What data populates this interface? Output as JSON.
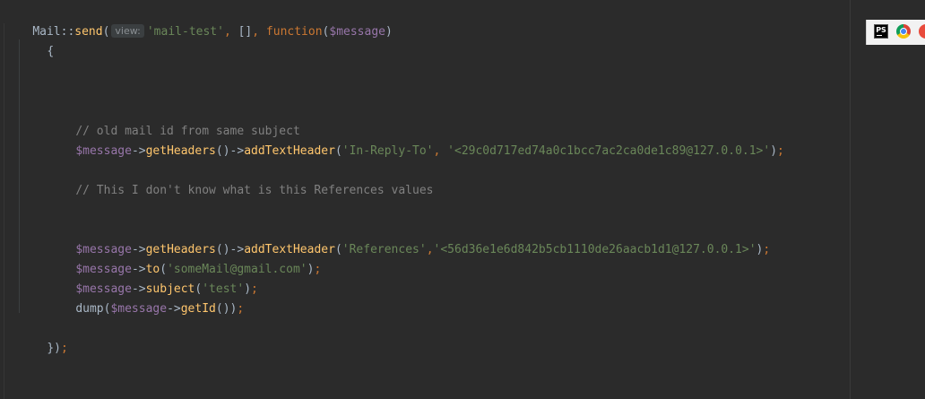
{
  "code": {
    "line1": {
      "class": "Mail",
      "sep": "::",
      "method": "send",
      "open": "(",
      "param_hint": "view:",
      "view_arg": "'mail-test'",
      "comma1": ", ",
      "array": "[]",
      "comma2": ", ",
      "keyword": "function",
      "paren_open": "(",
      "param": "$message",
      "paren_close": ")"
    },
    "line2": {
      "brace": "{"
    },
    "comment1": "// old mail id from same subject",
    "line_irt": {
      "var": "$message",
      "arrow1": "->",
      "fn1": "getHeaders",
      "p1": "()",
      "arrow2": "->",
      "fn2": "addTextHeader",
      "open": "(",
      "arg1": "'In-Reply-To'",
      "comma": ", ",
      "arg2": "'<29c0d717ed74a0c1bcc7ac2ca0de1c89@127.0.0.1>'",
      "close": ")",
      "semi": ";"
    },
    "comment2": "// This I don't know what is this References values",
    "line_refs": {
      "var": "$message",
      "arrow1": "->",
      "fn1": "getHeaders",
      "p1": "()",
      "arrow2": "->",
      "fn2": "addTextHeader",
      "open": "(",
      "arg1": "'References'",
      "comma": ",",
      "arg2": "'<56d36e1e6d842b5cb1110de26aacb1d1@127.0.0.1>'",
      "close": ")",
      "semi": ";"
    },
    "line_to": {
      "var": "$message",
      "arrow": "->",
      "fn": "to",
      "open": "(",
      "arg": "'someMail@gmail.com'",
      "close": ")",
      "semi": ";"
    },
    "line_subject": {
      "var": "$message",
      "arrow": "->",
      "fn": "subject",
      "open": "(",
      "arg": "'test'",
      "close": ")",
      "semi": ";"
    },
    "line_dump": {
      "fn": "dump",
      "open": "(",
      "var": "$message",
      "arrow": "->",
      "fn2": "getId",
      "inner": "()",
      "close": ")",
      "semi": ";"
    },
    "line_close": {
      "brace": "}",
      "paren": ")",
      "semi": ";"
    }
  },
  "tray": {
    "phpstorm_label": "PS",
    "icons": [
      "phpstorm-icon",
      "chrome-icon",
      "app-icon"
    ]
  },
  "colors": {
    "background": "#2b2b2b",
    "keyword": "#cc7832",
    "function": "#ffc66d",
    "variable": "#9876aa",
    "string": "#6a8759",
    "comment": "#808080",
    "plain": "#a9b7c6"
  }
}
